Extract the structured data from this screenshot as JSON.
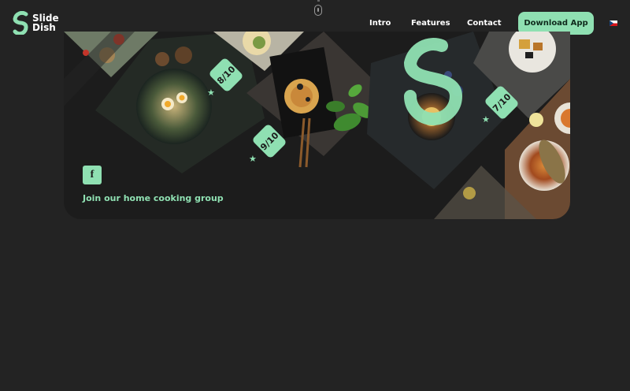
{
  "brand": {
    "name_line1": "Slide",
    "name_line2": "Dish"
  },
  "nav": {
    "intro": "Intro",
    "features": "Features",
    "contact": "Contact"
  },
  "cta": {
    "download": "Download App"
  },
  "hero": {
    "facebook_glyph": "f",
    "join_text": "Join our home cooking group",
    "ratings": [
      "8/10",
      "9/10",
      "7/10"
    ]
  },
  "colors": {
    "accent": "#8fe0b2",
    "background": "#232323",
    "card": "#1c1c1c"
  },
  "icons": [
    "logo-s-icon",
    "scroll-mouse-icon",
    "czech-flag-icon",
    "facebook-icon",
    "star-icon"
  ]
}
